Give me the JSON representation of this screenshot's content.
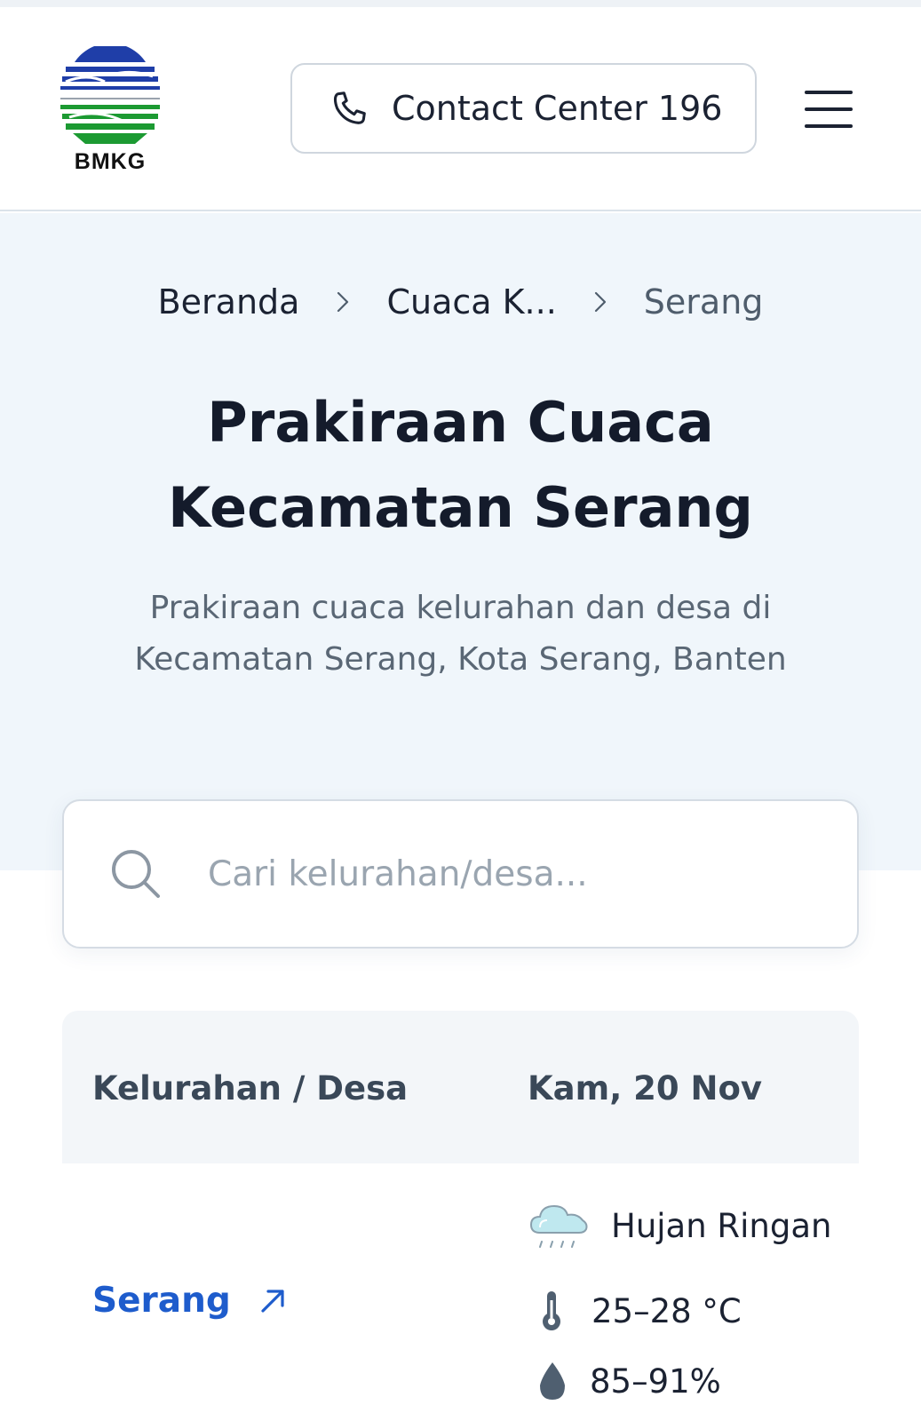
{
  "header": {
    "logo_text": "BMKG",
    "contact_label": "Contact Center 196",
    "icons": {
      "contact": "phone-icon",
      "menu": "hamburger-menu-icon"
    }
  },
  "breadcrumb": {
    "items": [
      "Beranda",
      "Cuaca K...",
      "Serang"
    ],
    "separator_icon": "chevron-right-icon"
  },
  "hero": {
    "title_line1": "Prakiraan Cuaca",
    "title_line2": "Kecamatan Serang",
    "subtitle_line1": "Prakiraan cuaca kelurahan dan desa di",
    "subtitle_line2": "Kecamatan Serang, Kota Serang, Banten"
  },
  "search": {
    "placeholder": "Cari kelurahan/desa...",
    "icon": "search-icon"
  },
  "table": {
    "headers": [
      "Kelurahan / Desa",
      "Kam, 20 Nov"
    ],
    "rows": [
      {
        "name": "Serang",
        "condition": "Hujan Ringan",
        "temperature": "25–28 °C",
        "humidity": "85–91%",
        "icons": {
          "link": "arrow-up-right-icon",
          "condition": "rain-cloud-icon",
          "temperature": "thermometer-icon",
          "humidity": "water-drop-icon"
        }
      }
    ]
  },
  "colors": {
    "link_blue": "#1e5ccc",
    "hero_bg": "#f0f6fb",
    "text_dark": "#141b2b",
    "logo_blue": "#1f3ea8",
    "logo_green": "#1c9a32"
  }
}
